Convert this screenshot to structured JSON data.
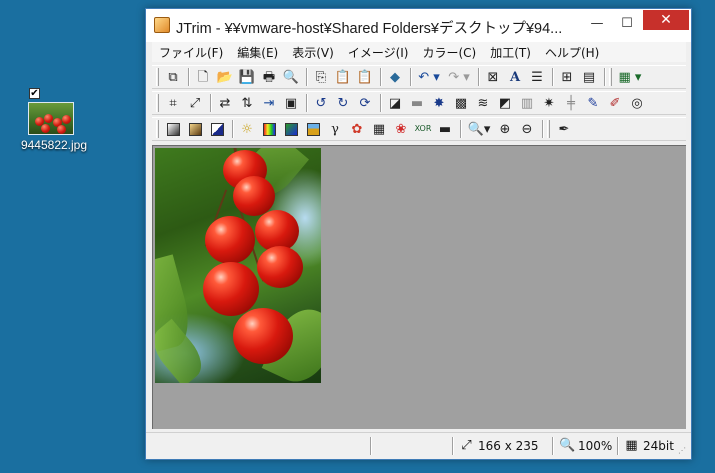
{
  "desktop": {
    "file_label": "9445822.jpg"
  },
  "window": {
    "title": "JTrim - ¥¥vmware-host¥Shared Folders¥デスクトップ¥94...",
    "controls": {
      "minimize": "—",
      "maximize": "☐",
      "close": "✕"
    }
  },
  "menu": {
    "items": [
      "ファイル(F)",
      "編集(E)",
      "表示(V)",
      "イメージ(I)",
      "カラー(C)",
      "加工(T)",
      "ヘルプ(H)"
    ]
  },
  "toolbar1": {
    "icons": [
      "new-window-icon",
      "new-file-icon",
      "open-folder-icon",
      "save-icon",
      "print-icon",
      "print-preview-icon",
      "copy-icon",
      "paste-icon",
      "paste-new-icon",
      "capture-icon",
      "undo-icon",
      "redo-icon",
      "fit-window-icon",
      "text-icon",
      "stripe-icon",
      "thumbnails-icon",
      "filmstrip-icon",
      "grid-icon"
    ]
  },
  "toolbar2": {
    "icons": [
      "crop-icon",
      "resize-icon",
      "flip-horizontal-icon",
      "flip-vertical-icon",
      "merge-icon",
      "frame-icon",
      "rotate-left-90-icon",
      "rotate-right-90-icon",
      "rotate-free-icon",
      "shadow-icon",
      "emboss-icon",
      "burst-icon",
      "mosaic-icon",
      "wave-icon",
      "tile-icon",
      "brick-icon",
      "star-icon",
      "grid-line-icon",
      "pen-icon",
      "eraser-pen-icon",
      "swirl-icon"
    ]
  },
  "toolbar3": {
    "icons": [
      "grayscale-icon",
      "sepia-icon",
      "invert-icon",
      "brightness-icon",
      "color-balance-icon",
      "gradient-icon",
      "picture-icon",
      "gamma-icon",
      "palette-icon",
      "dither-icon",
      "rgb-icon",
      "xor-icon",
      "posterize-icon",
      "zoom-dropdown-icon",
      "zoom-in-icon",
      "zoom-out-icon",
      "eyedropper-icon"
    ]
  },
  "status": {
    "image_size": "166 x 235",
    "zoom": "100%",
    "bit_depth": "24bit"
  }
}
